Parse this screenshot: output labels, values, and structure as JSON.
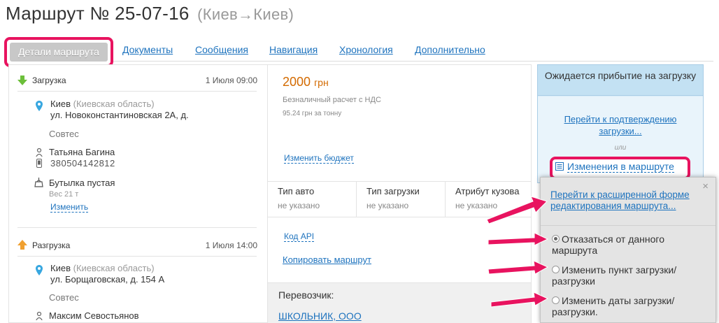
{
  "header": {
    "title": "Маршрут № 25-07-16",
    "route": "(Киев→Киев)"
  },
  "tabs": [
    {
      "label": "Детали маршрута"
    },
    {
      "label": "Документы"
    },
    {
      "label": "Сообщения"
    },
    {
      "label": "Навигация"
    },
    {
      "label": "Хронология"
    },
    {
      "label": "Дополнительно"
    }
  ],
  "loading": {
    "heading": "Загрузка",
    "date": "1 Июля 09:00",
    "city": "Киев",
    "region": "(Киевская область)",
    "street": "ул. Новоконстантиновская 2А, д.",
    "company": "Совтес",
    "person": "Татьяна Багина",
    "phone": "380504142812",
    "cargo": "Бутылка пустая",
    "weight": "Вес 21 т",
    "change_link": "Изменить"
  },
  "unloading": {
    "heading": "Разгрузка",
    "date": "1 Июля 14:00",
    "city": "Киев",
    "region": "(Киевская область)",
    "street": "ул. Борщаговская, д. 154 А",
    "company": "Совтес",
    "person": "Максим Севостьянов"
  },
  "budget": {
    "amount": "2000",
    "currency": "грн",
    "payment": "Безналичный расчет с НДС",
    "per_ton": "95.24 грн за тонну",
    "change_link": "Изменить бюджет"
  },
  "vehicle": {
    "cols": [
      {
        "header": "Тип авто",
        "value": "не указано"
      },
      {
        "header": "Тип загрузки",
        "value": "не указано"
      },
      {
        "header": "Атрибут кузова",
        "value": "не указано"
      }
    ]
  },
  "actions": {
    "api_code": "Код API",
    "copy_route": "Копировать маршрут"
  },
  "carrier": {
    "label": "Перевозчик:",
    "name": "ШКОЛЬНИК, ООО"
  },
  "status_panel": {
    "title": "Ожидается прибытие на загрузку",
    "confirm_link": "Перейти к подтверждению загрузки...",
    "or": "или",
    "changes_button": "Изменения в маршруте"
  },
  "popup": {
    "extended_link": "Перейти к расширенной форме редактирования маршрута...",
    "options": [
      {
        "label": "Отказаться от данного маршрута",
        "selected": true
      },
      {
        "label": "Изменить пункт загрузки/разгрузки",
        "selected": false
      },
      {
        "label": "Изменить даты загрузки/разгрузки.",
        "selected": false
      }
    ],
    "close": "×"
  },
  "colors": {
    "accent": "#e8135f",
    "link": "#1e73be",
    "price": "#d36a00",
    "panel": "#c3e1f3"
  }
}
